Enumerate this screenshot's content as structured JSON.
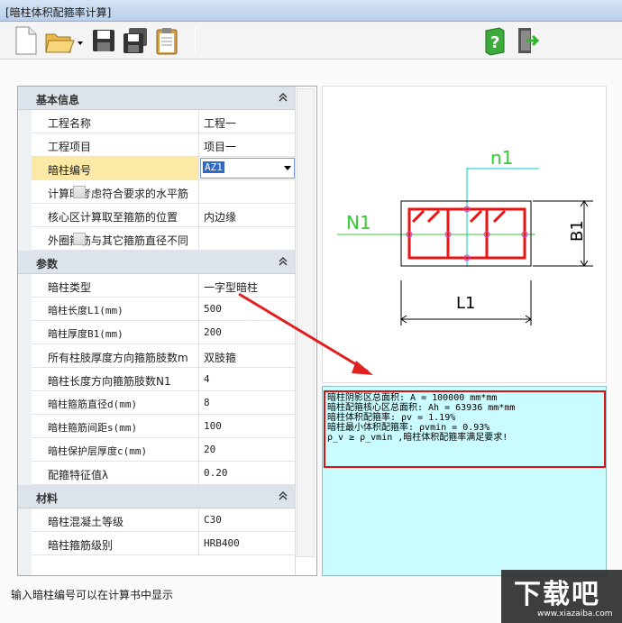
{
  "window": {
    "title": "[暗柱体积配箍率计算]"
  },
  "toolbar": {
    "buttons": [
      {
        "name": "new-file-icon"
      },
      {
        "name": "open-folder-icon"
      },
      {
        "name": "save-icon"
      },
      {
        "name": "save-as-icon"
      },
      {
        "name": "clipboard-icon"
      },
      {
        "name": "help-icon"
      },
      {
        "name": "exit-icon"
      }
    ]
  },
  "properties": {
    "basic": {
      "label": "基本信息",
      "rows": [
        {
          "name": "工程名称",
          "value": "工程一"
        },
        {
          "name": "工程项目",
          "value": "项目一"
        },
        {
          "name": "暗柱编号",
          "value": "AZ1"
        },
        {
          "name": "计算时考虑符合要求的水平筋",
          "value": ""
        },
        {
          "name": "核心区计算取至箍筋的位置",
          "value": "内边缘"
        },
        {
          "name": "外圈箍筋与其它箍筋直径不同",
          "value": ""
        }
      ]
    },
    "params": {
      "label": "参数",
      "rows": [
        {
          "name": "暗柱类型",
          "value": "一字型暗柱"
        },
        {
          "name": "暗柱长度L1(mm)",
          "value": "500"
        },
        {
          "name": "暗柱厚度B1(mm)",
          "value": "200"
        },
        {
          "name": "所有柱肢厚度方向箍筋肢数m",
          "value": "双肢箍"
        },
        {
          "name": "暗柱长度方向箍筋肢数N1",
          "value": "4"
        },
        {
          "name": "暗柱箍筋直径d(mm)",
          "value": "8"
        },
        {
          "name": "暗柱箍筋间距s(mm)",
          "value": "100"
        },
        {
          "name": "暗柱保护层厚度c(mm)",
          "value": "20"
        },
        {
          "name": "配箍特征值λ",
          "value": "0.20"
        }
      ]
    },
    "material": {
      "label": "材料",
      "rows": [
        {
          "name": "暗柱混凝土等级",
          "value": "C30"
        },
        {
          "name": "暗柱箍筋级别",
          "value": "HRB400"
        }
      ]
    }
  },
  "status_text": "输入暗柱编号可以在计算书中显示",
  "diagram": {
    "label_n1": "n1",
    "label_N1": "N1",
    "label_B1": "B1",
    "label_L1": "L1",
    "colors": {
      "rebar": "#ee1111",
      "axis": "#33cc33",
      "axis2": "#00cccc",
      "dim": "#000000"
    }
  },
  "report": {
    "lines": [
      "暗柱阴影区总面积: A = 100000 mm*mm",
      "暗柱配箍核心区总面积: Ah = 63936 mm*mm",
      "暗柱体积配箍率: ρv = 1.19%",
      "暗柱最小体积配箍率: ρvmin = 0.93%",
      "ρ_v ≥ ρ_vmin ,暗柱体积配箍率满足要求!"
    ]
  },
  "watermark": {
    "text": "下载吧",
    "url": "www.xiazaiba.com"
  }
}
